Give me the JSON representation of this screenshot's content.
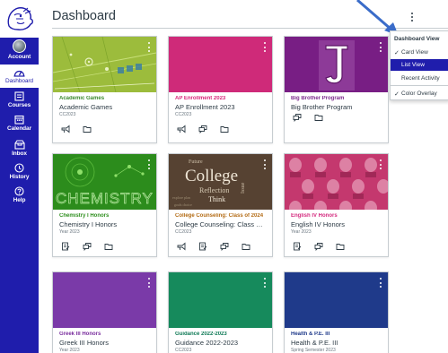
{
  "header": {
    "title": "Dashboard"
  },
  "global_nav": {
    "items": [
      {
        "label": "Account",
        "icon": "avatar"
      },
      {
        "label": "Dashboard",
        "icon": "dashboard-icon",
        "active": true
      },
      {
        "label": "Courses",
        "icon": "courses-icon"
      },
      {
        "label": "Calendar",
        "icon": "calendar-icon"
      },
      {
        "label": "Inbox",
        "icon": "inbox-icon"
      },
      {
        "label": "History",
        "icon": "history-icon"
      },
      {
        "label": "Help",
        "icon": "help-icon"
      }
    ]
  },
  "dashboard_menu": {
    "title": "Dashboard View",
    "items": [
      {
        "label": "Card View",
        "checked": true
      },
      {
        "label": "List View",
        "checked": false,
        "highlighted": true
      },
      {
        "label": "Recent Activity",
        "checked": false
      },
      {
        "label": "Color Overlay",
        "checked": true
      }
    ]
  },
  "cards": [
    {
      "short_name": "Academic Games",
      "name": "Academic Games",
      "term": "CC2023",
      "accent": "#3b8a2e",
      "icons": [
        "announcements-icon",
        "files-icon"
      ]
    },
    {
      "short_name": "AP Enrollment 2023",
      "name": "AP Enrollment 2023",
      "term": "CC2023",
      "accent": "#d8277a",
      "icons": [
        "announcements-icon",
        "discussions-icon",
        "files-icon"
      ]
    },
    {
      "short_name": "Big Brother Program",
      "name": "Big Brother Program",
      "term": "",
      "accent": "#7c2a8c",
      "icons": [
        "discussions-icon",
        "files-icon"
      ]
    },
    {
      "short_name": "Chemistry I Honors",
      "name": "Chemistry I Honors",
      "term": "Year 2023",
      "accent": "#2f8f1f",
      "icons": [
        "assignments-icon",
        "discussions-icon",
        "files-icon"
      ]
    },
    {
      "short_name": "College Counseling: Class of 2024",
      "name": "College Counseling: Class of 2...",
      "term": "CC2023",
      "accent": "#b36b14",
      "icons": [
        "announcements-icon",
        "assignments-icon",
        "discussions-icon",
        "files-icon"
      ]
    },
    {
      "short_name": "English IV Honors",
      "name": "English IV Honors",
      "term": "Year 2023",
      "accent": "#d42a7e",
      "icons": [
        "assignments-icon",
        "discussions-icon",
        "files-icon"
      ]
    },
    {
      "short_name": "Greek III Honors",
      "name": "Greek III Honors",
      "term": "Year 2023",
      "accent": "#7a2e9e",
      "icons": []
    },
    {
      "short_name": "Guidance 2022-2023",
      "name": "Guidance 2022-2023",
      "term": "CC2023",
      "accent": "#0f7a56",
      "icons": []
    },
    {
      "short_name": "Health & P.E. III",
      "name": "Health & P.E. III",
      "term": "Spring Semester 2023",
      "accent": "#1f3a8a",
      "icons": []
    }
  ],
  "hero_text": {
    "chemistry": "CHEMISTRY",
    "college": "College",
    "college_small_1": "Future",
    "college_small_2": "Reflection",
    "college_small_3": "Think",
    "college_small_4": "Issue"
  },
  "colors": {
    "nav_bg": "#1f1dac",
    "academic_games": "#8fb23a",
    "ap_enrollment": "#cf2a79",
    "big_brother": "#7a1f86",
    "chemistry": "#2f8f1f",
    "college": "#5a4636",
    "english": "#c8326d",
    "greek": "#7a3aa8",
    "guidance": "#168a5c",
    "health": "#1f3a8a"
  }
}
